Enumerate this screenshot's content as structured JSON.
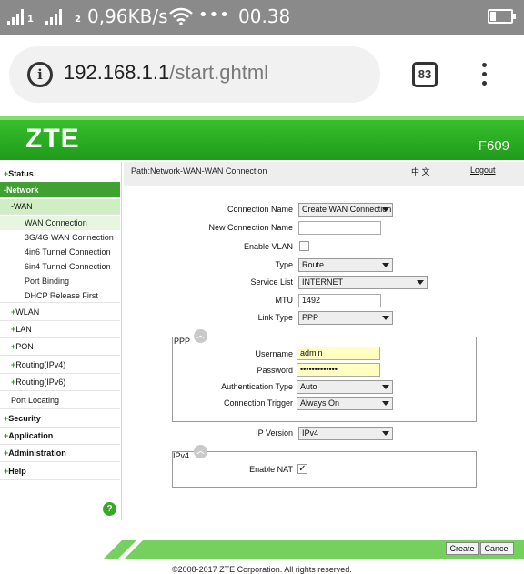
{
  "status_bar": {
    "speed": "0,96KB/s",
    "time": "00.38",
    "signal_icon": "signal-icon",
    "wifi_icon": "wifi-icon",
    "battery_icon": "battery-icon",
    "sim1_label": "1",
    "sim2_label": "2"
  },
  "browser": {
    "url_host": "192.168.1.1",
    "url_path": "/start.ghtml",
    "tab_count": "83"
  },
  "header": {
    "logo": "ZTE",
    "model": "F609"
  },
  "sidebar": {
    "status": "Status",
    "network": "Network",
    "wan": "WAN",
    "wan_items": [
      "WAN Connection",
      "3G/4G WAN Connection",
      "4in6 Tunnel Connection",
      "6in4 Tunnel Connection",
      "Port Binding",
      "DHCP Release First"
    ],
    "wlan": "WLAN",
    "lan": "LAN",
    "pon": "PON",
    "routing_v4": "Routing(IPv4)",
    "routing_v6": "Routing(IPv6)",
    "port_locating": "Port Locating",
    "security": "Security",
    "application": "Application",
    "administration": "Administration",
    "help": "Help",
    "plus": "+",
    "minus": "-",
    "help_icon": "?"
  },
  "path_bar": {
    "path": "Path:Network-WAN-WAN Connection",
    "language": "中 文",
    "logout": "Logout"
  },
  "form": {
    "connection_name_label": "Connection Name",
    "connection_name_value": "Create WAN Connection",
    "new_connection_name_label": "New Connection Name",
    "new_connection_name_value": "",
    "enable_vlan_label": "Enable VLAN",
    "type_label": "Type",
    "type_value": "Route",
    "service_list_label": "Service List",
    "service_list_value": "INTERNET",
    "mtu_label": "MTU",
    "mtu_value": "1492",
    "link_type_label": "Link Type",
    "link_type_value": "PPP",
    "ppp_title": "PPP",
    "username_label": "Username",
    "username_value": "admin",
    "password_label": "Password",
    "password_value": "•••••••••••••",
    "auth_type_label": "Authentication Type",
    "auth_type_value": "Auto",
    "conn_trigger_label": "Connection Trigger",
    "conn_trigger_value": "Always On",
    "ip_version_label": "IP Version",
    "ip_version_value": "IPv4",
    "ipv4_title": "IPv4",
    "enable_nat_label": "Enable NAT",
    "enable_vlan_checked": false,
    "enable_nat_checked": true,
    "check_glyph": "✓",
    "collapse_glyph": "︿"
  },
  "footer": {
    "create_label": "Create",
    "cancel_label": "Cancel",
    "copyright": "©2008-2017 ZTE Corporation. All rights reserved."
  },
  "colors": {
    "brand_green": "#2db325",
    "menu_selected": "#3fa130",
    "field_highlight": "#ffffc2"
  }
}
